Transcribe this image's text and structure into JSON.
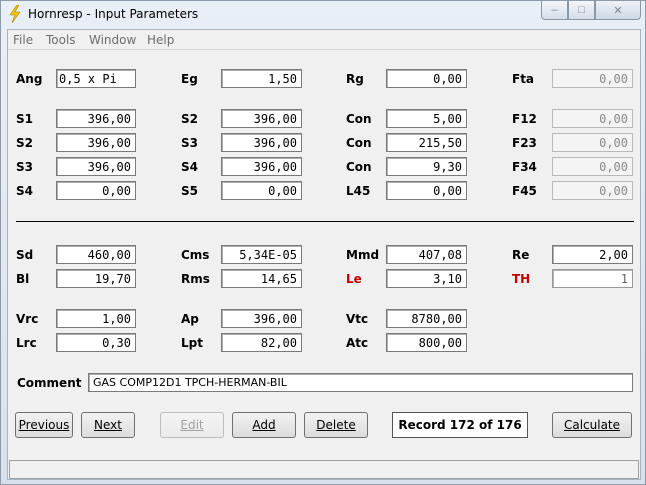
{
  "window": {
    "title": "Hornresp - Input Parameters",
    "caption_buttons": {
      "minimize": "–",
      "maximize": "□",
      "close": "✕"
    }
  },
  "menu": [
    "File",
    "Tools",
    "Window",
    "Help"
  ],
  "fields": {
    "ang": {
      "label": "Ang",
      "value": "0,5 x Pi"
    },
    "eg": {
      "label": "Eg",
      "value": "1,50"
    },
    "rg": {
      "label": "Rg",
      "value": "0,00"
    },
    "fta": {
      "label": "Fta",
      "value": "0,00"
    },
    "s1_a": {
      "label": "S1",
      "value": "396,00"
    },
    "s2_a": {
      "label": "S2",
      "value": "396,00"
    },
    "con1": {
      "label": "Con",
      "value": "5,00"
    },
    "f12": {
      "label": "F12",
      "value": "0,00"
    },
    "s2_b": {
      "label": "S2",
      "value": "396,00"
    },
    "s3_a": {
      "label": "S3",
      "value": "396,00"
    },
    "con2": {
      "label": "Con",
      "value": "215,50"
    },
    "f23": {
      "label": "F23",
      "value": "0,00"
    },
    "s3_b": {
      "label": "S3",
      "value": "396,00"
    },
    "s4_a": {
      "label": "S4",
      "value": "396,00"
    },
    "con3": {
      "label": "Con",
      "value": "9,30"
    },
    "f34": {
      "label": "F34",
      "value": "0,00"
    },
    "s4_b": {
      "label": "S4",
      "value": "0,00"
    },
    "s5": {
      "label": "S5",
      "value": "0,00"
    },
    "l45": {
      "label": "L45",
      "value": "0,00"
    },
    "f45": {
      "label": "F45",
      "value": "0,00"
    },
    "sd": {
      "label": "Sd",
      "value": "460,00"
    },
    "cms": {
      "label": "Cms",
      "value": "5,34E-05"
    },
    "mmd": {
      "label": "Mmd",
      "value": "407,08"
    },
    "re": {
      "label": "Re",
      "value": "2,00"
    },
    "bl": {
      "label": "Bl",
      "value": "19,70"
    },
    "rms": {
      "label": "Rms",
      "value": "14,65"
    },
    "le": {
      "label": "Le",
      "value": "3,10"
    },
    "th": {
      "label": "TH",
      "value": "1"
    },
    "vrc": {
      "label": "Vrc",
      "value": "1,00"
    },
    "ap": {
      "label": "Ap",
      "value": "396,00"
    },
    "vtc": {
      "label": "Vtc",
      "value": "8780,00"
    },
    "lrc": {
      "label": "Lrc",
      "value": "0,30"
    },
    "lpt": {
      "label": "Lpt",
      "value": "82,00"
    },
    "atc": {
      "label": "Atc",
      "value": "800,00"
    },
    "comment": {
      "label": "Comment",
      "value": "GAS COMP12D1 TPCH-HERMAN-BIL"
    }
  },
  "buttons": {
    "previous": {
      "label": "Previous"
    },
    "next": {
      "label": "Next"
    },
    "edit": {
      "label": "Edit"
    },
    "add": {
      "label": "Add"
    },
    "delete": {
      "label": "Delete"
    },
    "calculate": {
      "label": "Calculate"
    }
  },
  "record_status": "Record 172 of 176",
  "colors": {
    "accent_red": "#c00000",
    "disabled_text": "#8a8a8a"
  }
}
